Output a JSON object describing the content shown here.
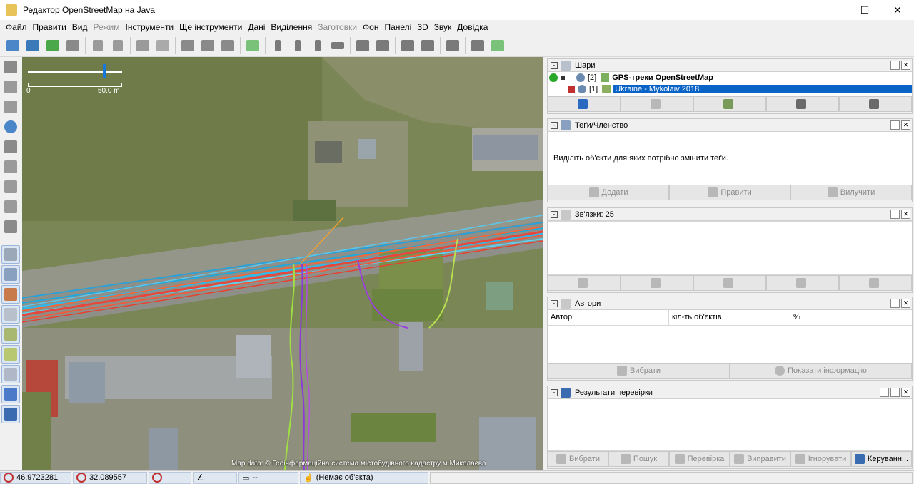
{
  "window": {
    "title": "Редактор OpenStreetMap на Java",
    "minimize": "—",
    "maximize": "☐",
    "close": "✕"
  },
  "menu": [
    {
      "label": "Файл",
      "disabled": false
    },
    {
      "label": "Правити",
      "disabled": false
    },
    {
      "label": "Вид",
      "disabled": false
    },
    {
      "label": "Режим",
      "disabled": true
    },
    {
      "label": "Інструменти",
      "disabled": false
    },
    {
      "label": "Ще інструменти",
      "disabled": false
    },
    {
      "label": "Дані",
      "disabled": false
    },
    {
      "label": "Виділення",
      "disabled": false
    },
    {
      "label": "Заготовки",
      "disabled": true
    },
    {
      "label": "Фон",
      "disabled": false
    },
    {
      "label": "Панелі",
      "disabled": false
    },
    {
      "label": "3D",
      "disabled": false
    },
    {
      "label": "Звук",
      "disabled": false
    },
    {
      "label": "Довідка",
      "disabled": false
    }
  ],
  "map": {
    "scale_start": "0",
    "scale_end": "50.0 m",
    "attribution": "Map data: © Геоінформаційна система містобудівного кадастру м.Миколаєва"
  },
  "panels": {
    "layers": {
      "title": "Шари",
      "rows": [
        {
          "index": "[2]",
          "name": "GPS-треки OpenStreetMap",
          "bold": true
        },
        {
          "index": "[1]",
          "name": "Ukraine - Mykolaiv 2018",
          "selected": true
        }
      ]
    },
    "tags": {
      "title": "Теґи/Членство",
      "hint": "Виділіть об'єкти для яких потрібно змінити теґи.",
      "buttons": [
        "Додати",
        "Правити",
        "Вилучити"
      ]
    },
    "relations": {
      "title": "Зв'язки: 25"
    },
    "authors": {
      "title": "Автори",
      "columns": [
        "Автор",
        "кіл-ть об'єктів",
        "%"
      ],
      "buttons": [
        "Вибрати",
        "Показати інформацію"
      ]
    },
    "validation": {
      "title": "Результати перевірки",
      "buttons": [
        "Вибрати",
        "Пошук",
        "Перевірка",
        "Виправити",
        "Ігнорувати",
        "Керуванн..."
      ]
    }
  },
  "status": {
    "lat": "46.9723281",
    "lon": "32.089557",
    "dist": "--",
    "object": "(Немає об'єкта)"
  }
}
